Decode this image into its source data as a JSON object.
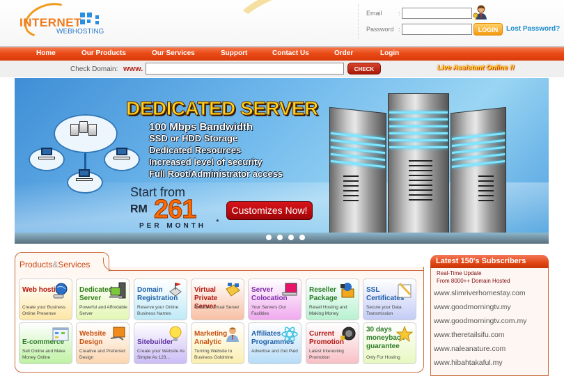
{
  "header": {
    "logo_text": "INTERNET",
    "logo_sub": "WEBHOSTING",
    "login": {
      "email_label": "Email",
      "email_colon": ":",
      "email_value": "",
      "password_label": "Password",
      "password_colon": ":",
      "password_value": "",
      "login_button": "LOGIN",
      "lost_password": "Lost Password?"
    }
  },
  "nav": {
    "items": [
      "Home",
      "Our Products",
      "Our Services",
      "Support",
      "Contact Us",
      "Order",
      "Login"
    ]
  },
  "domain_check": {
    "label": "Check Domain:",
    "prefix": "www.",
    "value": "",
    "button": "CHECK",
    "live_assistant": "Live Assistant Online !!"
  },
  "banner": {
    "title": "DEDICATED SERVER",
    "features": [
      "100 Mbps Bandwidth",
      "SSD or HDD Storage",
      "Dedicated Resources",
      "Increased level of security",
      "Full Root/Administrator access"
    ],
    "start_from": "Start from",
    "currency": "RM",
    "price": "261",
    "per_month": "PER MONTH",
    "asterisk": "*",
    "cta": "Customizes Now!",
    "slide_count": 4,
    "active_slide": 1
  },
  "products": {
    "title_part1": "Products",
    "title_amp": "&",
    "title_part2": "Services",
    "cards": [
      {
        "title": "Web hosting",
        "desc": "Create your Business Online Presense",
        "title_color": "#b3150f",
        "bg_from": "#ffffff",
        "bg_to": "#fde7a6",
        "icon": "globe-mouse-icon"
      },
      {
        "title": "Dedicated Server",
        "desc": "Powerful and Affordable Server",
        "title_color": "#2f7d1a",
        "bg_from": "#ffffff",
        "bg_to": "#e4f7b5",
        "icon": "server-monitor-icon"
      },
      {
        "title": "Domain Registration",
        "desc": "Reserve your Online Business Names",
        "title_color": "#1f5fa8",
        "bg_from": "#ffffff",
        "bg_to": "#bfeaf8",
        "icon": "flag-network-icon"
      },
      {
        "title": "Virtual Private Server",
        "desc": "Reliable Virtual Server",
        "title_color": "#b3150f",
        "bg_from": "#ffffff",
        "bg_to": "#f8c0a4",
        "icon": "folder-network-icon"
      },
      {
        "title": "Server Colocation",
        "desc": "Your Servers Our Facilities",
        "title_color": "#7b2aa8",
        "bg_from": "#ffffff",
        "bg_to": "#f0a9ee",
        "icon": "monitor-icon"
      },
      {
        "title": "Reseller Package",
        "desc": "Resell Hosting and Making Money",
        "title_color": "#2d7a2a",
        "bg_from": "#ffffff",
        "bg_to": "#b8f2d0",
        "icon": "shopping-basket-icon"
      },
      {
        "title": "SSL Certificates",
        "desc": "Secure your Data Transmission",
        "title_color": "#1f5fa8",
        "bg_from": "#ffffff",
        "bg_to": "#c3ccf6",
        "icon": "certificate-pen-icon"
      },
      {
        "title": "E-commerce",
        "desc": "Sell Online and Make Money Online",
        "title_color": "#2d7a2a",
        "bg_from": "#ffffff",
        "bg_to": "#bff2a4",
        "icon": "web-window-icon"
      },
      {
        "title": "Website Design",
        "desc": "Creative and Preferred Design",
        "title_color": "#c8500f",
        "bg_from": "#ffffff",
        "bg_to": "#fcd6b0",
        "icon": "design-monitor-icon"
      },
      {
        "title": "Sitebuilder",
        "desc": "Create your Website As Simple As 123...",
        "title_color": "#5b2fa0",
        "bg_from": "#ffffff",
        "bg_to": "#cbbcf6",
        "icon": "light-bulb-icon"
      },
      {
        "title": "Marketing Analytic",
        "desc": "Turning Website to Business Goldmine",
        "title_color": "#c8500f",
        "bg_from": "#ffffff",
        "bg_to": "#fbeeb0",
        "icon": "businessman-icon"
      },
      {
        "title": "Affiliates Programmes",
        "desc": "Advertise and Get Paid",
        "title_color": "#1f5fa8",
        "bg_from": "#ffffff",
        "bg_to": "#b6dcf8",
        "icon": "atom-icon"
      },
      {
        "title": "Current Promotion",
        "desc": "Latest Interesting Promotion",
        "title_color": "#b3150f",
        "bg_from": "#ffffff",
        "bg_to": "#f8c0c6",
        "icon": "megaphone-icon"
      },
      {
        "title": "30 days moneyback guarantee",
        "desc": "Only For Hosting",
        "title_color": "#2d7a2a",
        "bg_from": "#ffffff",
        "bg_to": "#e8f8c0",
        "icon": "star-icon"
      }
    ]
  },
  "subscribers": {
    "title": "Latest 150's Subscribers",
    "subtitle1": "Real-Time Update",
    "subtitle2": "From 8000++ Domain Hosted",
    "items": [
      "www.slimriverhomestay.com",
      "www.goodmorningtv.my",
      "www.goodmorningtv.com.my",
      "www.theretailsifu.com",
      "www.naleanature.com",
      "www.hibahtakaful.my"
    ]
  },
  "colors": {
    "brand_orange": "#e8461a",
    "link_blue": "#1e8ccf",
    "accent_red": "#b3271a"
  }
}
